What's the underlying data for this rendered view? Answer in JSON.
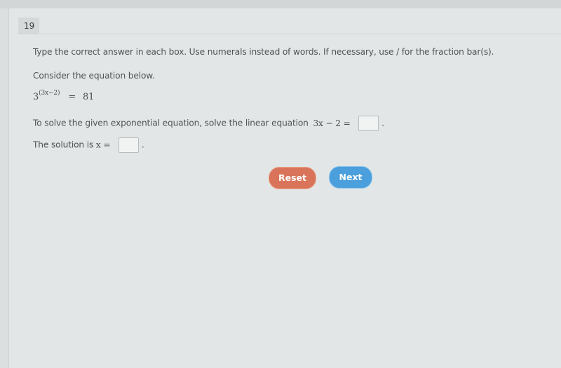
{
  "question": {
    "number": "19",
    "instructions": "Type the correct answer in each box. Use numerals instead of words. If necessary, use / for the fraction bar(s).",
    "prompt": "Consider the equation below.",
    "equation": {
      "base": "3",
      "exponent": "(3x−2)",
      "equals": "=",
      "rhs": "81"
    },
    "line1": {
      "text": "To solve the given exponential equation, solve the linear equation",
      "expr": "3x − 2 =",
      "answer_value": "",
      "suffix": "."
    },
    "line2": {
      "text": "The solution is",
      "expr": "x =",
      "answer_value": "",
      "suffix": "."
    }
  },
  "buttons": {
    "reset_label": "Reset",
    "next_label": "Next"
  },
  "colors": {
    "reset": "#d9745a",
    "next": "#4a9fdc",
    "background": "#e3e6e6"
  }
}
